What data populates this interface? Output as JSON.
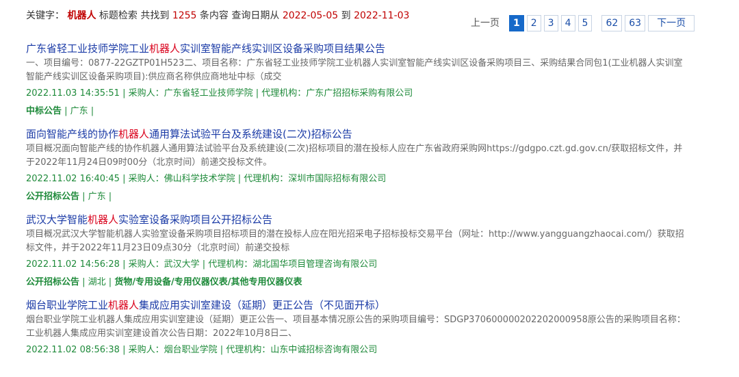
{
  "summary": {
    "prefix": "关键字：",
    "keyword": "机器人",
    "mode": "标题检索 共找到",
    "count": "1255",
    "count_suffix": "条内容 查询日期从",
    "date_from": "2022-05-05",
    "date_to_label": "到",
    "date_to": "2022-11-03"
  },
  "pager": {
    "prev": "上一页",
    "pages": [
      "1",
      "2",
      "3",
      "4",
      "5"
    ],
    "last_pages": [
      "62",
      "63"
    ],
    "next": "下一页",
    "current": "1"
  },
  "results": [
    {
      "title_pre": "广东省轻工业技师学院工业",
      "title_kw": "机器人",
      "title_post": "实训室智能产线实训区设备采购项目结果公告",
      "desc": "一、项目编号：0877-22GZTP01H523二、项目名称：广东省轻工业技师学院工业机器人实训室智能产线实训区设备采购项目三、采购结果合同包1(工业机器人实训室智能产线实训区设备采购项目):供应商名称供应商地址中标（成交",
      "meta": "2022.11.03 14:35:51 | 采购人：广东省轻工业技师学院 | 代理机构：广东广招招标采购有限公司",
      "tag_type": "中标公告",
      "tag_rest": " | 广东 |"
    },
    {
      "title_pre": "面向智能产线的协作",
      "title_kw": "机器人",
      "title_post": "通用算法试验平台及系统建设(二次)招标公告",
      "desc": "项目概况面向智能产线的协作机器人通用算法试验平台及系统建设(二次)招标项目的潜在投标人应在广东省政府采购网https://gdgpo.czt.gd.gov.cn/获取招标文件，并于2022年11月24日09时00分（北京时间）前递交投标文件。",
      "meta": "2022.11.02 16:40:45 | 采购人：佛山科学技术学院 | 代理机构：深圳市国际招标有限公司",
      "tag_type": "公开招标公告",
      "tag_rest": " | 广东 |"
    },
    {
      "title_pre": "武汉大学智能",
      "title_kw": "机器人",
      "title_post": "实验室设备采购项目公开招标公告",
      "desc": "项目概况武汉大学智能机器人实验室设备采购项目招标项目的潜在投标人应在阳光招采电子招标投标交易平台（网址：http://www.yangguangzhaocai.com/）获取招标文件，并于2022年11月23日09点30分（北京时间）前递交投标",
      "meta": "2022.11.02 14:56:28 | 采购人：武汉大学 | 代理机构：湖北国华项目管理咨询有限公司",
      "tag_type": "公开招标公告",
      "tag_rest": " | 湖北 | ",
      "tag_extra": "货物/专用设备/专用仪器仪表/其他专用仪器仪表"
    },
    {
      "title_pre": "烟台职业学院工业",
      "title_kw": "机器人",
      "title_post": "集成应用实训室建设（延期）更正公告（不见面开标）",
      "desc": "烟台职业学院工业机器人集成应用实训室建设（延期）更正公告一、项目基本情况原公告的采购项目编号：SDGP370600000202202000958原公告的采购项目名称：工业机器人集成应用实训室建设首次公告日期：2022年10月8日二、",
      "meta": "2022.11.02 08:56:38 | 采购人：烟台职业学院 | 代理机构：山东中诚招标咨询有限公司"
    }
  ]
}
